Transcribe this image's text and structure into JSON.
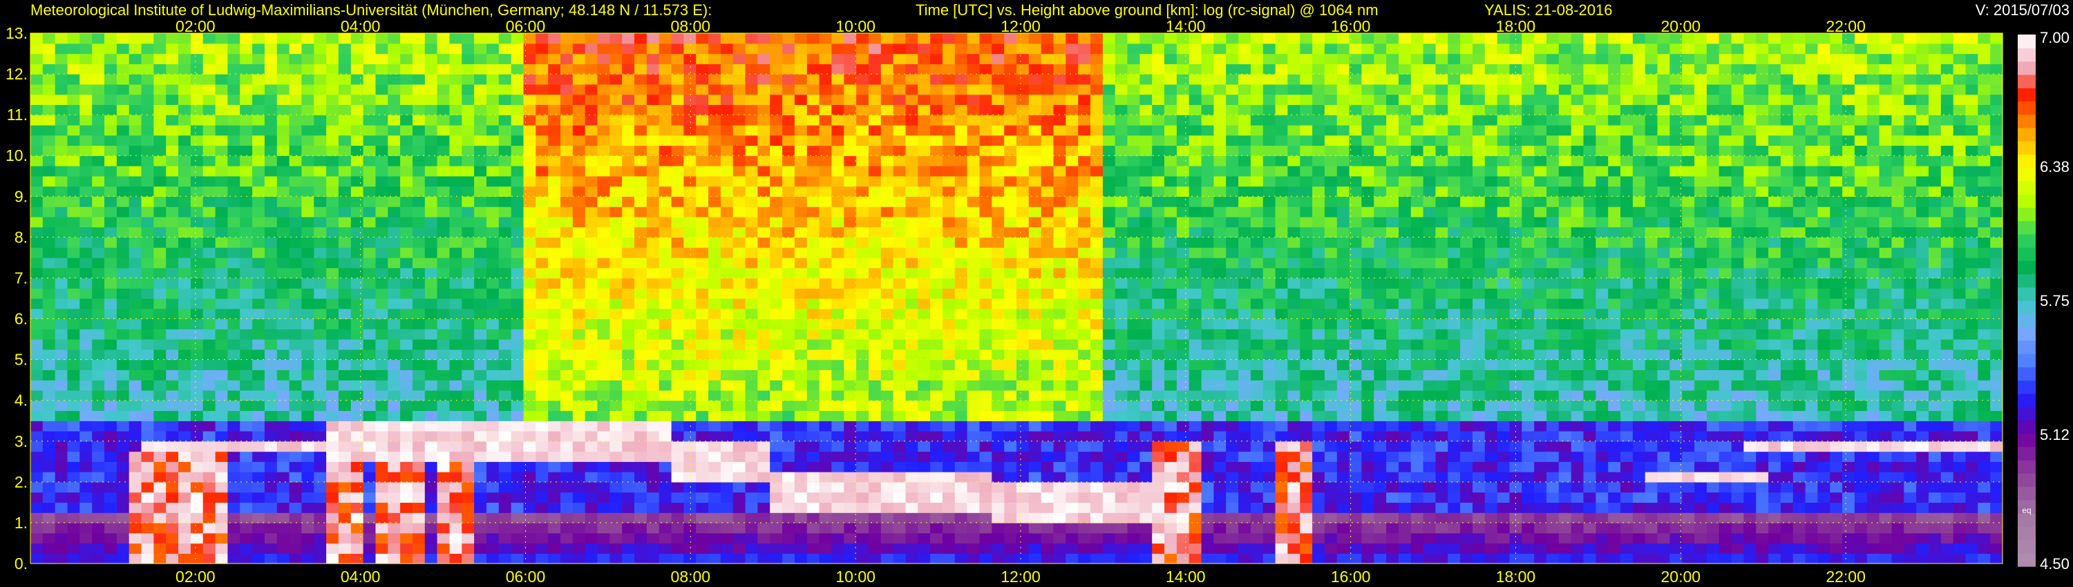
{
  "header": {
    "institute": "Meteorological Institute of Ludwig-Maximilians-Universität (München, Germany; 48.148 N / 11.573 E):",
    "description": "Time [UTC] vs. Height above ground [km]: log (rc-signal) @ 1064 nm",
    "instrument_date": "YALIS: 21-08-2016",
    "version": "V: 2015/07/03"
  },
  "chart_data": {
    "type": "heatmap",
    "title": "Time [UTC] vs. Height above ground [km]: log (rc-signal) @ 1064 nm",
    "x_unit": "hours UTC",
    "xlim": [
      0,
      23.9
    ],
    "x_ticks": [
      {
        "value": 2,
        "label": "02:00"
      },
      {
        "value": 4,
        "label": "04:00"
      },
      {
        "value": 6,
        "label": "06:00"
      },
      {
        "value": 8,
        "label": "08:00"
      },
      {
        "value": 10,
        "label": "10:00"
      },
      {
        "value": 12,
        "label": "12:00"
      },
      {
        "value": 14,
        "label": "14:00"
      },
      {
        "value": 16,
        "label": "16:00"
      },
      {
        "value": 18,
        "label": "18:00"
      },
      {
        "value": 20,
        "label": "20:00"
      },
      {
        "value": 22,
        "label": "22:00"
      }
    ],
    "y_unit": "km",
    "ylim": [
      0,
      13
    ],
    "y_ticks": [
      {
        "value": 0,
        "label": "0."
      },
      {
        "value": 1,
        "label": "1."
      },
      {
        "value": 2,
        "label": "2."
      },
      {
        "value": 3,
        "label": "3."
      },
      {
        "value": 4,
        "label": "4."
      },
      {
        "value": 5,
        "label": "5."
      },
      {
        "value": 6,
        "label": "6."
      },
      {
        "value": 7,
        "label": "7."
      },
      {
        "value": 8,
        "label": "8."
      },
      {
        "value": 9,
        "label": "9."
      },
      {
        "value": 10,
        "label": "10."
      },
      {
        "value": 11,
        "label": "11."
      },
      {
        "value": 12,
        "label": "12."
      },
      {
        "value": 13,
        "label": "13."
      }
    ],
    "grid": true,
    "colorbar": {
      "min": 4.5,
      "max": 7.0,
      "ticks": [
        {
          "value": 7.0,
          "label": "7.00"
        },
        {
          "value": 6.38,
          "label": "6.38"
        },
        {
          "value": 5.75,
          "label": "5.75"
        },
        {
          "value": 5.12,
          "label": "5.12"
        },
        {
          "value": 4.5,
          "label": "4.50"
        }
      ],
      "small_label": "eq",
      "small_label_value": 4.75,
      "stops": [
        {
          "value": 4.5,
          "color": "#b08fae"
        },
        {
          "value": 4.72,
          "color": "#a57aa5"
        },
        {
          "value": 4.95,
          "color": "#8c3c9a"
        },
        {
          "value": 5.12,
          "color": "#7000a0"
        },
        {
          "value": 5.3,
          "color": "#2020ff"
        },
        {
          "value": 5.45,
          "color": "#4c7bff"
        },
        {
          "value": 5.6,
          "color": "#78a8ff"
        },
        {
          "value": 5.75,
          "color": "#40c8c8"
        },
        {
          "value": 5.9,
          "color": "#00b050"
        },
        {
          "value": 6.05,
          "color": "#30d060"
        },
        {
          "value": 6.2,
          "color": "#b0ff00"
        },
        {
          "value": 6.38,
          "color": "#ffff00"
        },
        {
          "value": 6.55,
          "color": "#ffa000"
        },
        {
          "value": 6.72,
          "color": "#ff2000"
        },
        {
          "value": 6.85,
          "color": "#f0b0c0"
        },
        {
          "value": 7.0,
          "color": "#ffffff"
        }
      ]
    },
    "field": {
      "surface_level": 4.9,
      "background_level": 5.75,
      "high_level": 6.2,
      "cloud_level": 7.0,
      "cloud_layers": [
        {
          "x": [
            1.3,
            3.6
          ],
          "y": [
            2.7,
            3.0
          ]
        },
        {
          "x": [
            3.6,
            7.8
          ],
          "y": [
            2.6,
            3.4
          ]
        },
        {
          "x": [
            7.8,
            9.0
          ],
          "y": [
            2.0,
            2.9
          ]
        },
        {
          "x": [
            9.0,
            11.6
          ],
          "y": [
            1.3,
            2.3
          ]
        },
        {
          "x": [
            11.6,
            13.8
          ],
          "y": [
            1.1,
            2.0
          ]
        },
        {
          "x": [
            20.8,
            23.9
          ],
          "y": [
            2.7,
            3.0
          ]
        },
        {
          "x": [
            19.5,
            21.0
          ],
          "y": [
            1.9,
            2.3
          ]
        }
      ],
      "precip_columns": [
        {
          "x": 1.5,
          "top": 2.8
        },
        {
          "x": 2.1,
          "top": 3.0
        },
        {
          "x": 3.8,
          "top": 3.0
        },
        {
          "x": 4.5,
          "top": 3.2
        },
        {
          "x": 5.2,
          "top": 3.0
        },
        {
          "x": 13.9,
          "top": 3.0
        },
        {
          "x": 15.3,
          "top": 3.0
        }
      ]
    }
  }
}
